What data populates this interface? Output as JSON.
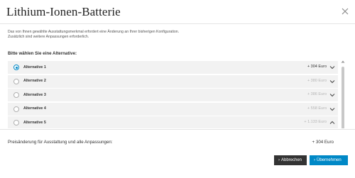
{
  "dialog": {
    "title": "Lithium-Ionen-Batterie",
    "close_icon": "close-icon"
  },
  "info": {
    "line1": "Das von Ihnen gewählte Ausstattungsmerkmal erfordert eine Änderung an Ihrer bisherigen Konfiguration.",
    "line2": "Zusätzlich sind weitere Anpassungen erforderlich."
  },
  "prompt": "Bitte wählen Sie eine Alternative:",
  "alternatives": [
    {
      "label": "Alternative 1",
      "price": "+ 304 Euro",
      "selected": true,
      "expanded": false
    },
    {
      "label": "Alternative 2",
      "price": "+ 380 Euro",
      "selected": false,
      "expanded": false
    },
    {
      "label": "Alternative 3",
      "price": "+ 386 Euro",
      "selected": false,
      "expanded": false
    },
    {
      "label": "Alternative 4",
      "price": "+ 558 Euro",
      "selected": false,
      "expanded": false
    },
    {
      "label": "Alternative 5",
      "price": "+ 1.133 Euro",
      "selected": false,
      "expanded": true
    }
  ],
  "total": {
    "label": "Preisänderung für Ausstattung und alle Anpassungen:",
    "value": "+ 304 Euro"
  },
  "buttons": {
    "cancel": "Abbrechen",
    "accept": "Übernehmen",
    "cancel_caret": "›",
    "accept_caret": "›"
  },
  "colors": {
    "accent": "#0088c6",
    "cancel_bg": "#333333",
    "row_bg": "#f2f2f2"
  }
}
